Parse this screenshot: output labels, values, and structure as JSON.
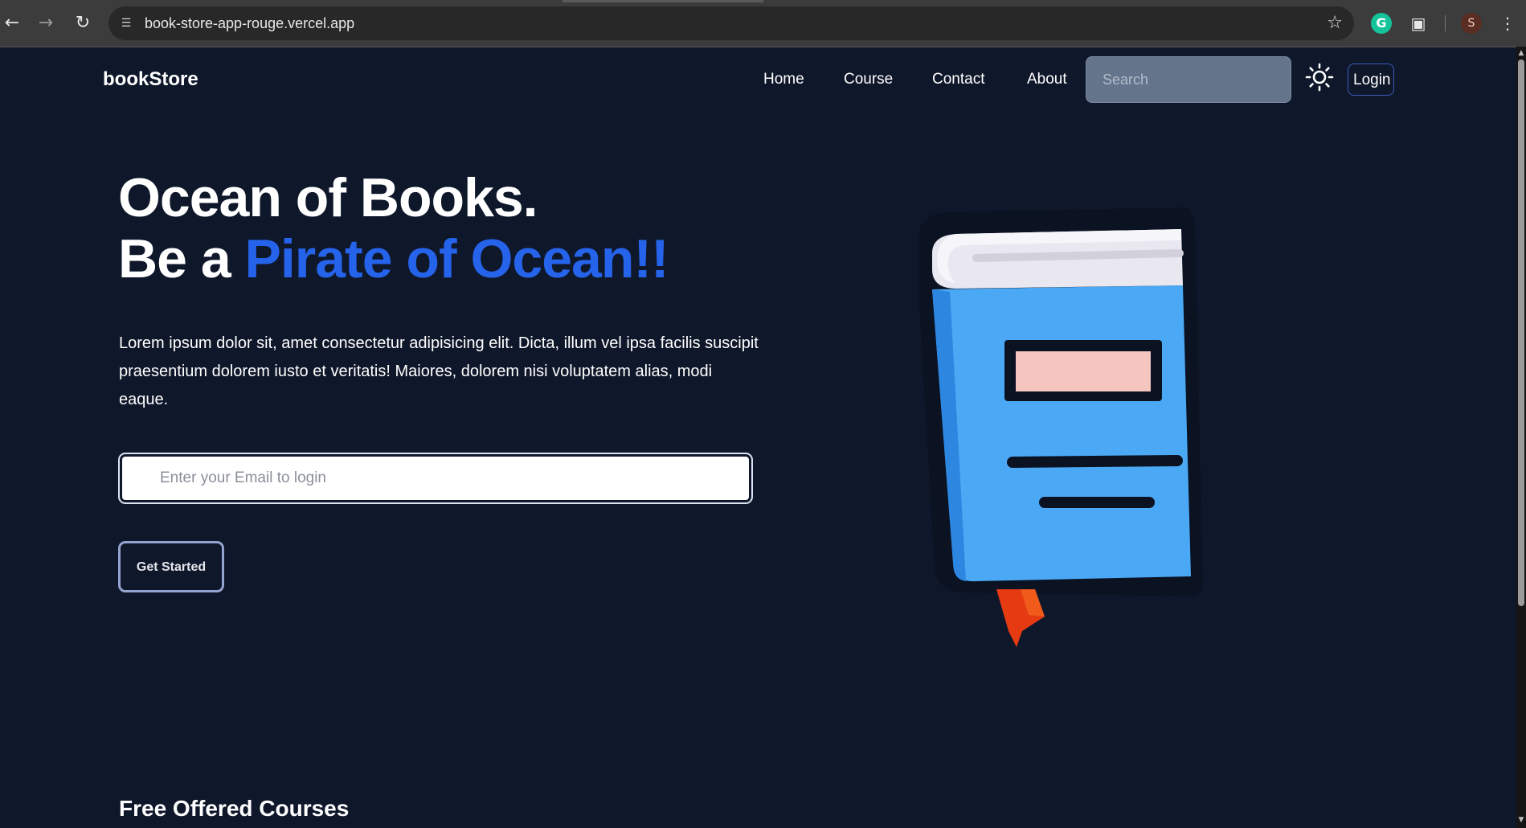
{
  "browser": {
    "url": "book-store-app-rouge.vercel.app",
    "back_icon": "arrow-left-icon",
    "forward_icon": "arrow-right-icon",
    "reload_icon": "reload-icon",
    "bookmark_icon": "star-icon",
    "grammarly_label": "G",
    "extensions_icon": "puzzle-icon",
    "profile_initial": "S",
    "menu_icon": "kebab-menu-icon"
  },
  "navbar": {
    "brand": "bookStore",
    "links": [
      "Home",
      "Course",
      "Contact",
      "About"
    ],
    "search_placeholder": "Search",
    "theme_icon": "sun-icon",
    "login_label": "Login"
  },
  "hero": {
    "title_line1": "Ocean of Books.",
    "title_line2_prefix": "Be a ",
    "title_line2_accent": "Pirate of Ocean!!",
    "description": "Lorem ipsum dolor sit, amet consectetur adipisicing elit. Dicta, illum vel ipsa facilis suscipit praesentium dolorem iusto et veritatis! Maiores, dolorem nisi voluptatem alias, modi eaque.",
    "email_placeholder": "Enter your Email to login",
    "cta_label": "Get Started",
    "illustration_icon": "book-icon"
  },
  "courses": {
    "title": "Free Offered Courses"
  },
  "colors": {
    "background": "#0f172a",
    "accent": "#2563eb",
    "search_bg": "#64748b"
  }
}
